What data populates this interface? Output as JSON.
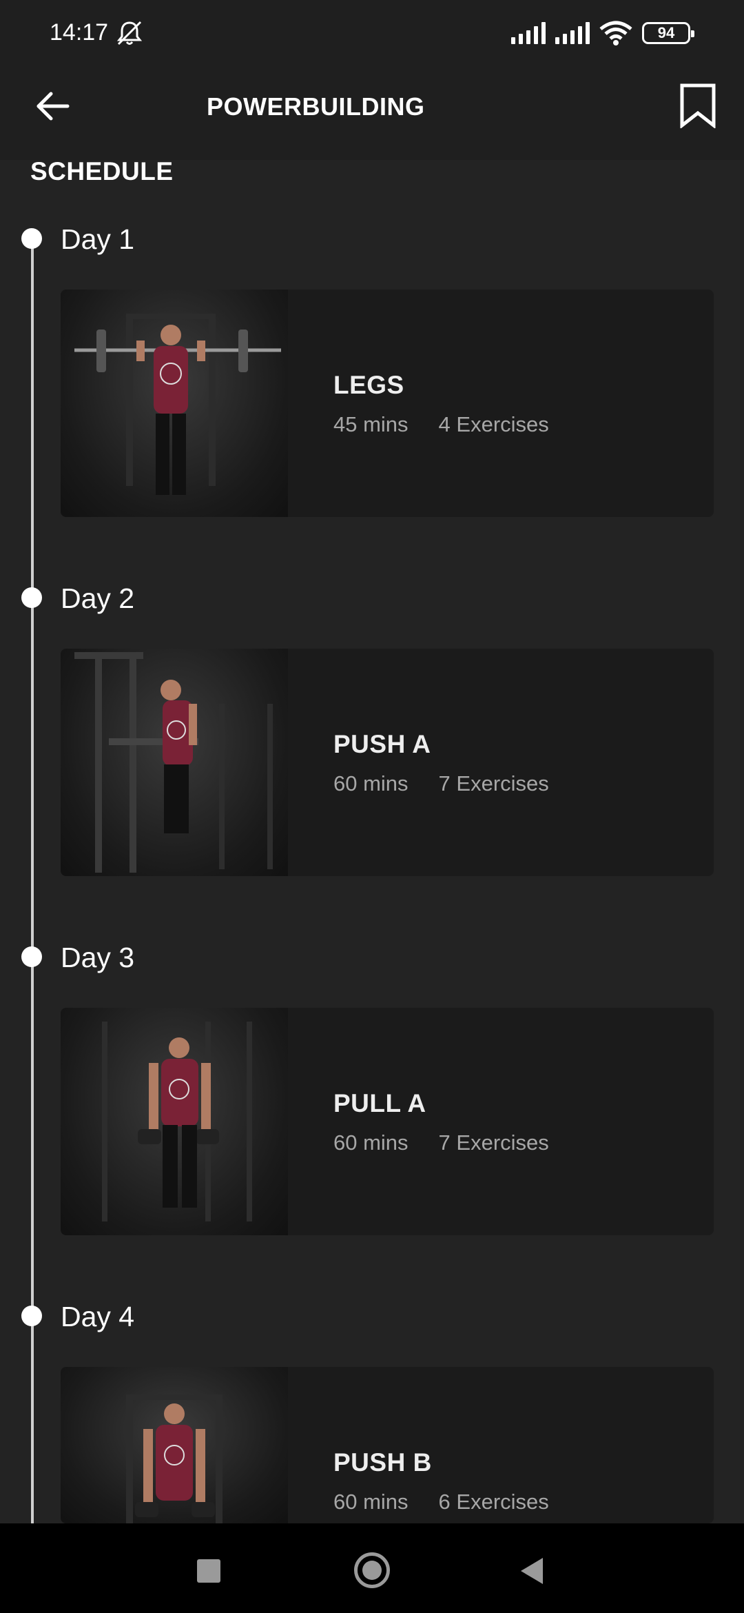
{
  "status_bar": {
    "time": "14:17",
    "battery": "94",
    "icons": [
      "mute-icon",
      "signal-icon",
      "signal-icon",
      "wifi-icon",
      "battery-icon"
    ]
  },
  "header": {
    "title": "POWERBUILDING",
    "back_icon": "arrow-left-icon",
    "bookmark_icon": "bookmark-icon"
  },
  "schedule": {
    "title": "SCHEDULE",
    "days": [
      {
        "day": "Day 1",
        "workout": "LEGS",
        "duration": "45 mins",
        "exercises": "4 Exercises"
      },
      {
        "day": "Day 2",
        "workout": "PUSH A",
        "duration": "60 mins",
        "exercises": "7 Exercises"
      },
      {
        "day": "Day 3",
        "workout": "PULL A",
        "duration": "60 mins",
        "exercises": "7 Exercises"
      },
      {
        "day": "Day 4",
        "workout": "PUSH B",
        "duration": "60 mins",
        "exercises": "6 Exercises"
      }
    ]
  },
  "colors": {
    "background": "#232323",
    "card": "#1b1b1b",
    "accent_shirt": "#7a2236"
  }
}
